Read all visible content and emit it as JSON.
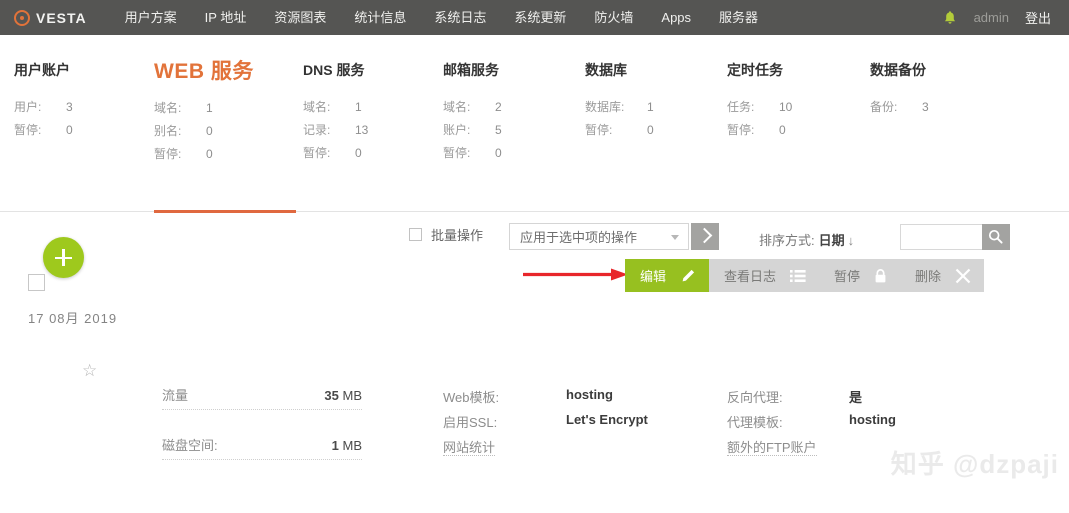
{
  "topnav": {
    "brand": "VESTA",
    "brand_icon": "vesta-ring-logo",
    "items": [
      {
        "label": "用户方案",
        "name": "user-packages"
      },
      {
        "label": "IP 地址",
        "name": "ip-addresses"
      },
      {
        "label": "资源图表",
        "name": "resource-charts"
      },
      {
        "label": "统计信息",
        "name": "statistics"
      },
      {
        "label": "系统日志",
        "name": "system-logs"
      },
      {
        "label": "系统更新",
        "name": "system-updates"
      },
      {
        "label": "防火墙",
        "name": "firewall"
      },
      {
        "label": "Apps",
        "name": "apps"
      },
      {
        "label": "服务器",
        "name": "server"
      }
    ],
    "bell_icon": "notification-bell-icon",
    "user": "admin",
    "logout": "登出",
    "bg_color": "#555553",
    "bell_color": "#b3cc3a"
  },
  "stats": [
    {
      "title": "用户账户",
      "active": false,
      "rows": [
        {
          "label": "用户:",
          "value": "3"
        },
        {
          "label": "暂停:",
          "value": "0"
        }
      ]
    },
    {
      "title": "WEB 服务",
      "active": true,
      "rows": [
        {
          "label": "域名:",
          "value": "1"
        },
        {
          "label": "别名:",
          "value": "0"
        },
        {
          "label": "暂停:",
          "value": "0"
        }
      ]
    },
    {
      "title": "DNS 服务",
      "active": false,
      "rows": [
        {
          "label": "域名:",
          "value": "1"
        },
        {
          "label": "记录:",
          "value": "13"
        },
        {
          "label": "暂停:",
          "value": "0"
        }
      ]
    },
    {
      "title": "邮箱服务",
      "active": false,
      "rows": [
        {
          "label": "域名:",
          "value": "2"
        },
        {
          "label": "账户:",
          "value": "5"
        },
        {
          "label": "暂停:",
          "value": "0"
        }
      ]
    },
    {
      "title": "数据库",
      "active": false,
      "rows": [
        {
          "label": "数据库:",
          "value": "1"
        },
        {
          "label": "暂停:",
          "value": "0"
        }
      ]
    },
    {
      "title": "定时任务",
      "active": false,
      "rows": [
        {
          "label": "任务:",
          "value": "10"
        },
        {
          "label": "暂停:",
          "value": "0"
        }
      ]
    },
    {
      "title": "数据备份",
      "active": false,
      "rows": [
        {
          "label": "备份:",
          "value": "3"
        }
      ]
    }
  ],
  "active_tab_color": "#e0683f",
  "toolbar": {
    "batch_label": "批量操作",
    "batch_checked": false,
    "select_value": "应用于选中项的操作",
    "select_caret_icon": "chevron-down-icon",
    "go_icon": "chevron-right-icon",
    "sort_label": "排序方式:",
    "sort_value": "日期",
    "sort_direction_icon": "↓",
    "search_value": "",
    "search_placeholder": "",
    "search_icon": "search-icon"
  },
  "actions": [
    {
      "label": "编辑",
      "icon": "pencil-icon",
      "primary": true,
      "name": "edit-button"
    },
    {
      "label": "查看日志",
      "icon": "list-icon",
      "primary": false,
      "name": "view-logs-button"
    },
    {
      "label": "暂停",
      "icon": "lock-icon",
      "primary": false,
      "name": "suspend-button"
    },
    {
      "label": "删除",
      "icon": "close-x-icon",
      "primary": false,
      "name": "delete-button"
    }
  ],
  "action_primary_color": "#97c020",
  "action_secondary_color": "#d5d5d5",
  "annotation": {
    "arrow_color": "#e8262a",
    "arrow_icon": "red-right-arrow"
  },
  "row": {
    "checked": false,
    "add_icon": "plus-icon",
    "add_color": "#9ec91d",
    "date": "17 08月 2019",
    "star_icon": "star-icon",
    "metrics": [
      {
        "key": "流量",
        "value_num": "35",
        "value_unit": "MB",
        "name": "traffic"
      },
      {
        "key": "磁盘空间:",
        "value_num": "1",
        "value_unit": "MB",
        "name": "disk-space"
      }
    ],
    "details_mid": [
      {
        "key": "Web模板:",
        "value": "hosting",
        "link": false
      },
      {
        "key": "启用SSL:",
        "value": "Let's Encrypt",
        "link": false
      },
      {
        "key": "网站统计",
        "value": "",
        "link": true
      }
    ],
    "details_right": [
      {
        "key": "反向代理:",
        "value": "是",
        "link": false
      },
      {
        "key": "代理模板:",
        "value": "hosting",
        "link": false
      },
      {
        "key": "额外的FTP账户",
        "value": "",
        "link": true
      }
    ]
  },
  "watermark": "知乎 @dzpaji"
}
